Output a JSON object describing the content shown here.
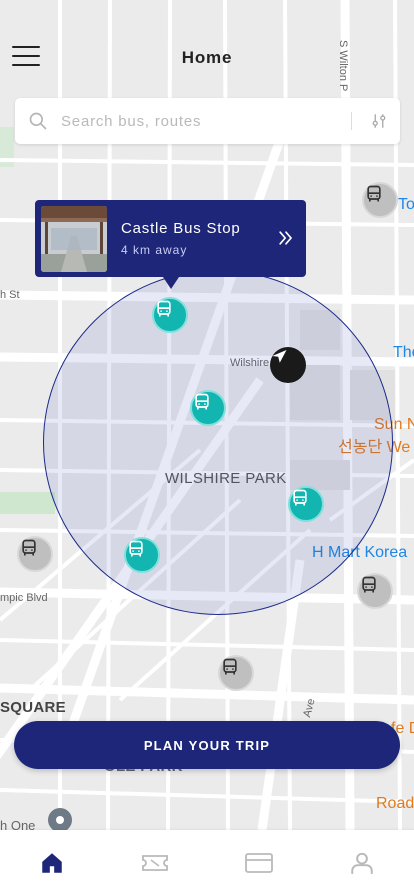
{
  "header": {
    "title": "Home"
  },
  "search": {
    "placeholder": "Search bus, routes"
  },
  "callout": {
    "stop_name": "Castle Bus Stop",
    "distance": "4 km away"
  },
  "map_labels": {
    "s_wilton": "S Wilton P",
    "h_st": "h St",
    "wilshire": "Wilshire",
    "wilshire_park": "WILSHIRE PARK",
    "the": "The",
    "sun_n": "Sun N",
    "korean_we": "선농단 We",
    "h_mart": "H Mart Korea",
    "mpic_blvd": "mpic Blvd",
    "square": "SQUARE",
    "ave": "Ave",
    "fe_d": "fe D",
    "road": "Road",
    "park_partial": "OLE PARK",
    "h_one": "h One",
    "tor": "Tor"
  },
  "cta": {
    "label": "PLAN YOUR TRIP"
  },
  "tabs": [
    {
      "name": "home",
      "icon": "home-icon",
      "active": true
    },
    {
      "name": "tickets",
      "icon": "ticket-icon",
      "active": false
    },
    {
      "name": "cards",
      "icon": "card-icon",
      "active": false
    },
    {
      "name": "profile",
      "icon": "profile-icon",
      "active": false
    }
  ],
  "colors": {
    "primary": "#1d2678",
    "teal": "#12b5b0",
    "inactive_bus": "#bfbfbf"
  }
}
